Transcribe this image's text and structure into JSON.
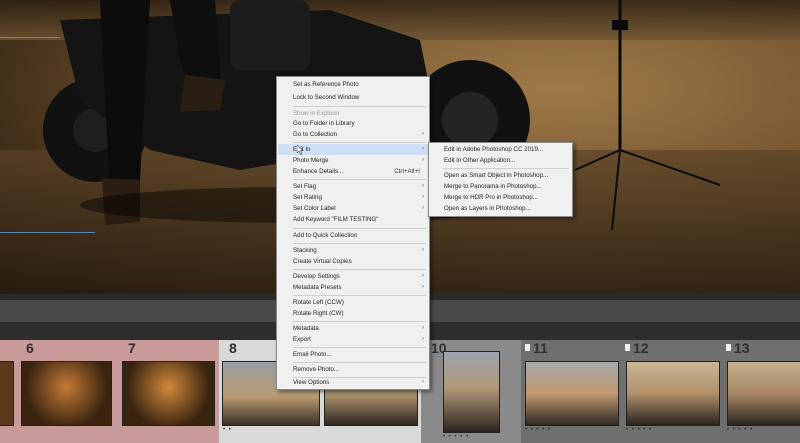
{
  "context_menu": {
    "items": [
      {
        "label": "Set as Reference Photo",
        "disabled": false,
        "arrow": false,
        "shortcut": ""
      },
      {
        "label": "Lock to Second Window",
        "disabled": false,
        "arrow": false,
        "shortcut": ""
      },
      {
        "label": "Show in Explorer",
        "disabled": true,
        "arrow": false,
        "shortcut": ""
      },
      {
        "label": "Go to Folder in Library",
        "disabled": false,
        "arrow": false,
        "shortcut": ""
      },
      {
        "label": "Go to Collection",
        "disabled": false,
        "arrow": true,
        "shortcut": ""
      },
      {
        "label": "Edit In",
        "disabled": false,
        "arrow": true,
        "shortcut": "",
        "highlighted": true
      },
      {
        "label": "Photo Merge",
        "disabled": false,
        "arrow": true,
        "shortcut": ""
      },
      {
        "label": "Enhance Details...",
        "disabled": false,
        "arrow": false,
        "shortcut": "Ctrl+Alt+I"
      },
      {
        "label": "Set Flag",
        "disabled": false,
        "arrow": true,
        "shortcut": ""
      },
      {
        "label": "Set Rating",
        "disabled": false,
        "arrow": true,
        "shortcut": ""
      },
      {
        "label": "Set Color Label",
        "disabled": false,
        "arrow": true,
        "shortcut": ""
      },
      {
        "label": "Add Keyword \"FILM TESTING\"",
        "disabled": false,
        "arrow": false,
        "shortcut": ""
      },
      {
        "label": "Add to Quick Collection",
        "disabled": false,
        "arrow": false,
        "shortcut": ""
      },
      {
        "label": "Stacking",
        "disabled": false,
        "arrow": true,
        "shortcut": ""
      },
      {
        "label": "Create Virtual Copies",
        "disabled": false,
        "arrow": false,
        "shortcut": ""
      },
      {
        "label": "Develop Settings",
        "disabled": false,
        "arrow": true,
        "shortcut": ""
      },
      {
        "label": "Metadata Presets",
        "disabled": false,
        "arrow": true,
        "shortcut": ""
      },
      {
        "label": "Rotate Left (CCW)",
        "disabled": false,
        "arrow": false,
        "shortcut": ""
      },
      {
        "label": "Rotate Right (CW)",
        "disabled": false,
        "arrow": false,
        "shortcut": ""
      },
      {
        "label": "Metadata",
        "disabled": false,
        "arrow": true,
        "shortcut": ""
      },
      {
        "label": "Export",
        "disabled": false,
        "arrow": true,
        "shortcut": ""
      },
      {
        "label": "Email Photo...",
        "disabled": false,
        "arrow": false,
        "shortcut": ""
      },
      {
        "label": "Remove Photo...",
        "disabled": false,
        "arrow": false,
        "shortcut": ""
      },
      {
        "label": "View Options",
        "disabled": false,
        "arrow": true,
        "shortcut": ""
      }
    ]
  },
  "submenu": {
    "items": [
      {
        "label": "Edit in Adobe Photoshop CC 2019..."
      },
      {
        "label": "Edit in Other Application..."
      },
      {
        "label": "Open as Smart Object in Photoshop..."
      },
      {
        "label": "Merge to Panorama in Photoshop..."
      },
      {
        "label": "Merge to HDR Pro in Photoshop..."
      },
      {
        "label": "Open as Layers in Photoshop..."
      }
    ]
  },
  "filmstrip": {
    "cells": [
      {
        "number": "6",
        "bg": "#c99a9a",
        "flag": false,
        "stars": ""
      },
      {
        "number": "7",
        "bg": "#c99a9a",
        "flag": false,
        "stars": ""
      },
      {
        "number": "8",
        "bg": "#d9d9d9",
        "flag": false,
        "stars": "• •"
      },
      {
        "number": "",
        "bg": "#d9d9d9",
        "flag": false,
        "stars": ""
      },
      {
        "number": "10",
        "bg": "#8a8a8a",
        "flag": false,
        "stars": "• • • • •"
      },
      {
        "number": "11",
        "bg": "#6f6f6f",
        "flag": true,
        "stars": "• • • • •"
      },
      {
        "number": "12",
        "bg": "#6f6f6f",
        "flag": true,
        "stars": "• • • • •"
      },
      {
        "number": "13",
        "bg": "#6f6f6f",
        "flag": true,
        "stars": "• • • • •"
      }
    ]
  },
  "icons": {
    "submenu_arrow": "chevron-right-icon",
    "cursor": "mouse-pointer-icon",
    "flag": "flag-icon"
  },
  "colors": {
    "menu_bg": "#f0f0f0",
    "menu_highlight": "#cfe0f5",
    "selected_range": "#c99a9a"
  }
}
